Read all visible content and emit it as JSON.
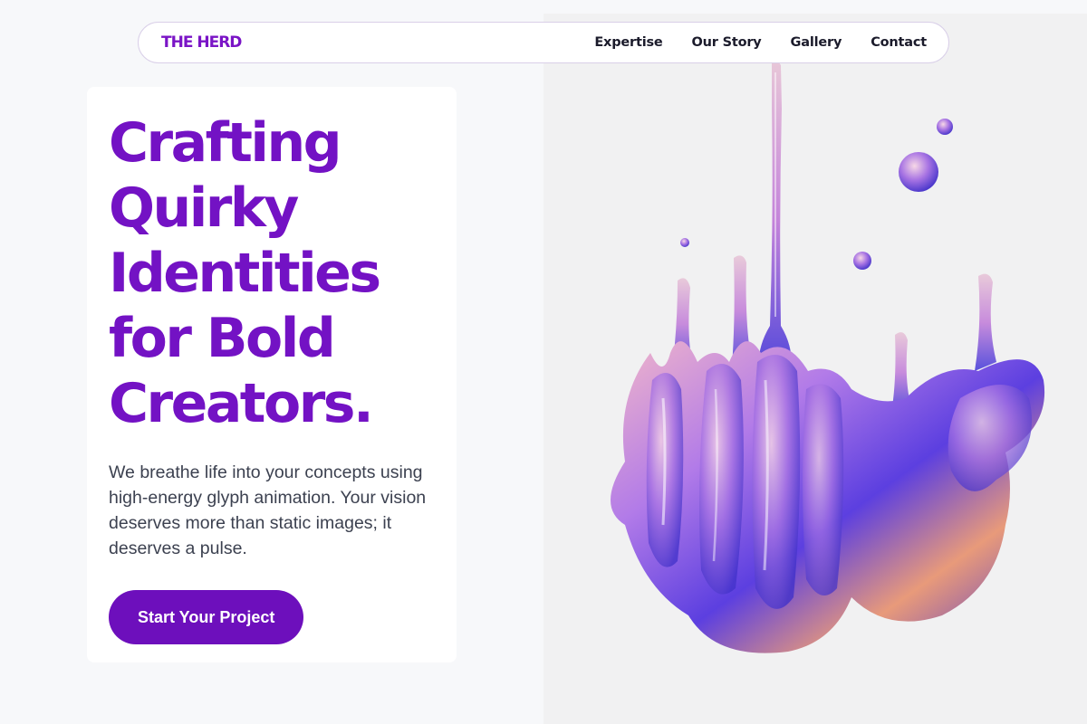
{
  "brand": {
    "logo": "THE HERD",
    "accent": "#7312c4"
  },
  "nav": {
    "links": [
      {
        "label": "Expertise"
      },
      {
        "label": "Our Story"
      },
      {
        "label": "Gallery"
      },
      {
        "label": "Contact"
      }
    ]
  },
  "hero": {
    "headline_lines": [
      "Crafting",
      "Quirky",
      "Identities",
      "for Bold",
      "Creators."
    ],
    "body": "We breathe life into your concepts using high-energy glyph animation. Your vision deserves more than static images; it deserves a pulse.",
    "cta_label": "Start Your Project"
  },
  "art": {
    "icon": "liquid-splash-illustration"
  }
}
